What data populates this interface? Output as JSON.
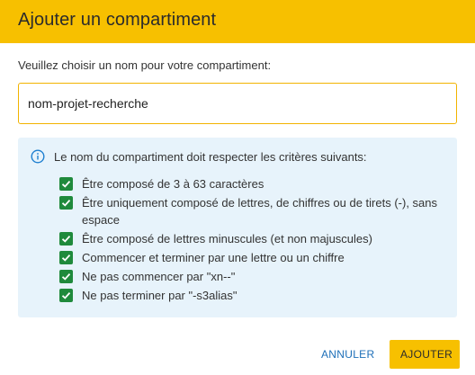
{
  "dialog": {
    "title": "Ajouter un compartiment",
    "prompt": "Veuillez choisir un nom pour votre compartiment:",
    "name_input": {
      "value": "nom-projet-recherche",
      "placeholder": ""
    },
    "info": {
      "icon": "info-circle-icon",
      "heading": "Le nom du compartiment doit respecter les critères suivants:",
      "criteria": [
        "Être composé de 3 à 63 caractères",
        "Être uniquement composé de lettres, de chiffres ou de tirets (-), sans espace",
        "Être composé de lettres minuscules (et non majuscules)",
        "Commencer et terminer par une lettre ou un chiffre",
        "Ne pas commencer par \"xn--\"",
        "Ne pas terminer par \"-s3alias\""
      ]
    },
    "buttons": {
      "cancel": "ANNULER",
      "add": "AJOUTER"
    }
  },
  "colors": {
    "accent": "#f7c000",
    "info_bg": "#e7f3fb",
    "check": "#1f8a3c",
    "link": "#1d6fb8"
  }
}
